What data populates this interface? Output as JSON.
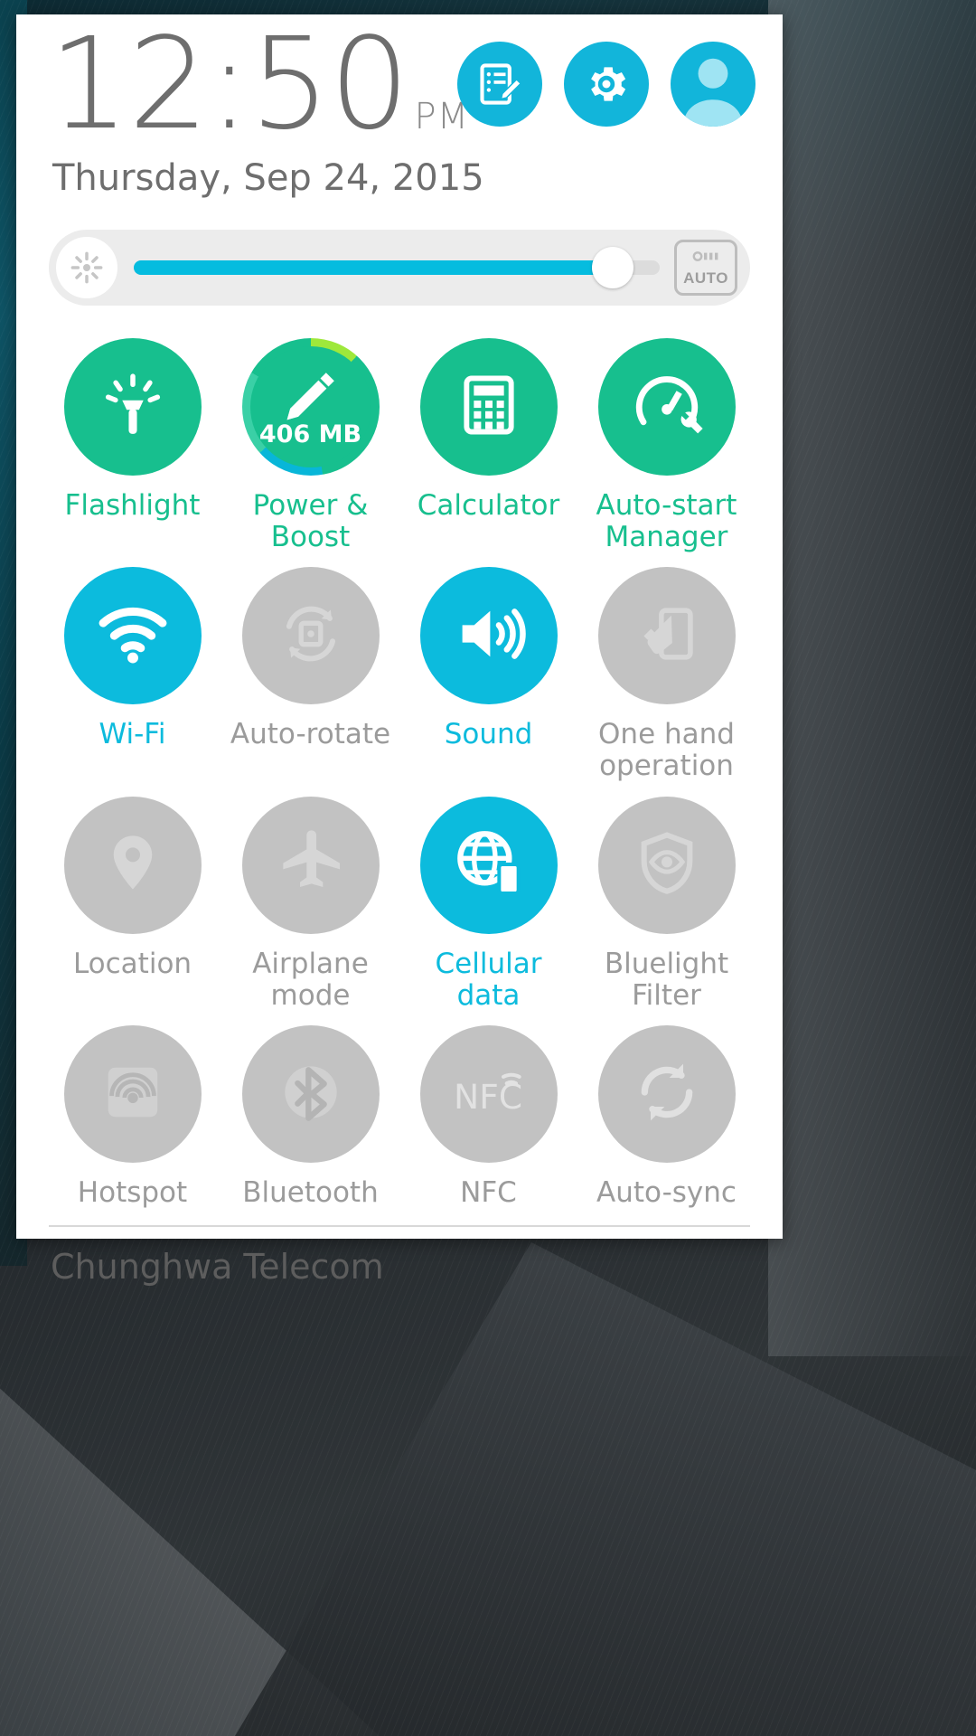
{
  "header": {
    "time": "12:50",
    "ampm": "PM",
    "date": "Thursday, Sep 24, 2015",
    "actions": [
      {
        "name": "quick-memo-button",
        "icon": "notepad-edit-icon",
        "label": "Quick memo"
      },
      {
        "name": "settings-button",
        "icon": "gear-icon",
        "label": "Settings"
      },
      {
        "name": "user-profile-button",
        "icon": "avatar-icon",
        "label": "User profile"
      }
    ]
  },
  "brightness": {
    "icon": "brightness-sun-icon",
    "value_percent": 91,
    "auto_label": "AUTO",
    "auto_icon": "auto-brightness-icon"
  },
  "tiles": [
    {
      "label": "Flashlight",
      "icon": "flashlight-icon",
      "state": "app",
      "color": "#17bf8e"
    },
    {
      "label": "Power & Boost",
      "icon": "boost-brush-icon",
      "state": "app",
      "color": "#17bf8e",
      "badge": "406 MB"
    },
    {
      "label": "Calculator",
      "icon": "calculator-icon",
      "state": "app",
      "color": "#17bf8e"
    },
    {
      "label": "Auto-start Manager",
      "icon": "autostart-gauge-icon",
      "state": "app",
      "color": "#17bf8e"
    },
    {
      "label": "Wi-Fi",
      "icon": "wifi-icon",
      "state": "on",
      "color": "#0cbbdd"
    },
    {
      "label": "Auto-rotate",
      "icon": "auto-rotate-icon",
      "state": "off",
      "color": "#c2c2c2"
    },
    {
      "label": "Sound",
      "icon": "sound-icon",
      "state": "on",
      "color": "#0cbbdd"
    },
    {
      "label": "One hand operation",
      "icon": "one-hand-icon",
      "state": "off",
      "color": "#c2c2c2"
    },
    {
      "label": "Location",
      "icon": "location-pin-icon",
      "state": "off",
      "color": "#c2c2c2"
    },
    {
      "label": "Airplane mode",
      "icon": "airplane-icon",
      "state": "off",
      "color": "#c2c2c2"
    },
    {
      "label": "Cellular data",
      "icon": "cellular-data-icon",
      "state": "on",
      "color": "#0cbbdd"
    },
    {
      "label": "Bluelight Filter",
      "icon": "bluelight-shield-icon",
      "state": "off",
      "color": "#c2c2c2"
    },
    {
      "label": "Hotspot",
      "icon": "hotspot-icon",
      "state": "off",
      "color": "#c2c2c2"
    },
    {
      "label": "Bluetooth",
      "icon": "bluetooth-icon",
      "state": "off",
      "color": "#c2c2c2"
    },
    {
      "label": "NFC",
      "icon": "nfc-icon",
      "state": "off",
      "color": "#c2c2c2"
    },
    {
      "label": "Auto-sync",
      "icon": "auto-sync-icon",
      "state": "off",
      "color": "#c2c2c2"
    }
  ],
  "footer": {
    "carrier": "Chunghwa Telecom"
  }
}
